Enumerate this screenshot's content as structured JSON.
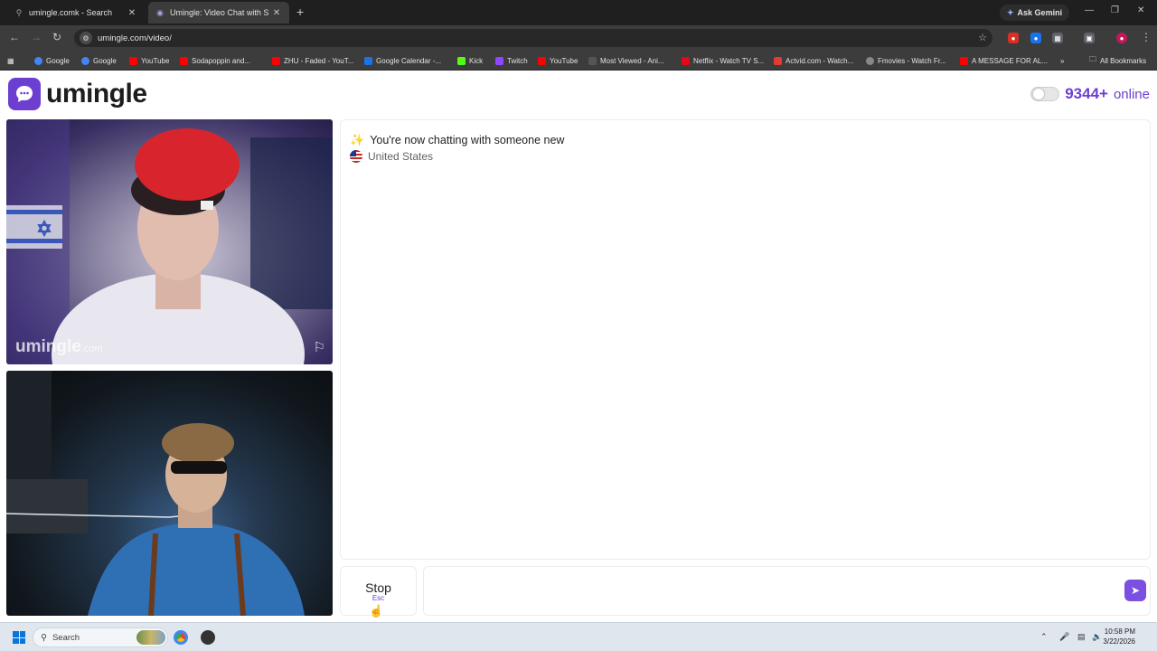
{
  "browser": {
    "tabs": [
      {
        "title": "umingle.comk - Search",
        "icon": "search-icon"
      },
      {
        "title": "Umingle: Video Chat with S",
        "icon": "umingle-tab-icon"
      }
    ],
    "ask_gemini": "Ask Gemini",
    "url": "umingle.com/video/",
    "bookmarks": [
      {
        "label": "Google",
        "color": "#4285f4"
      },
      {
        "label": "Google",
        "color": "#4285f4"
      },
      {
        "label": "YouTube",
        "color": "#ff0000"
      },
      {
        "label": "Sodapoppin and...",
        "color": "#ff0000"
      },
      {
        "label": "ZHU - Faded - YouT...",
        "color": "#ff0000"
      },
      {
        "label": "Google Calendar -...",
        "color": "#1a73e8"
      },
      {
        "label": "Kick",
        "color": "#53fc18"
      },
      {
        "label": "Twitch",
        "color": "#9146ff"
      },
      {
        "label": "YouTube",
        "color": "#ff0000"
      },
      {
        "label": "Most Viewed - Ani...",
        "color": "#555555"
      },
      {
        "label": "Netflix - Watch TV S...",
        "color": "#e50914"
      },
      {
        "label": "Actvid.com - Watch...",
        "color": "#e53935"
      },
      {
        "label": "Fmovies - Watch Fr...",
        "color": "#888888"
      },
      {
        "label": "A MESSAGE FOR AL...",
        "color": "#ff0000"
      }
    ],
    "all_bookmarks": "All Bookmarks"
  },
  "site": {
    "logo_text": "umingle",
    "online_count": "9344+",
    "online_label": "online",
    "accent_color": "#6c3fd1"
  },
  "stranger_video": {
    "watermark": "umingle",
    "watermark_domain": ".com"
  },
  "chat": {
    "system_message": "You're now chatting with someone new",
    "country": "United States"
  },
  "controls": {
    "stop_label": "Stop",
    "stop_shortcut": "Esc",
    "message_placeholder": ""
  },
  "taskbar": {
    "search_label": "Search",
    "time": "10:58 PM",
    "date": "3/22/2026"
  }
}
